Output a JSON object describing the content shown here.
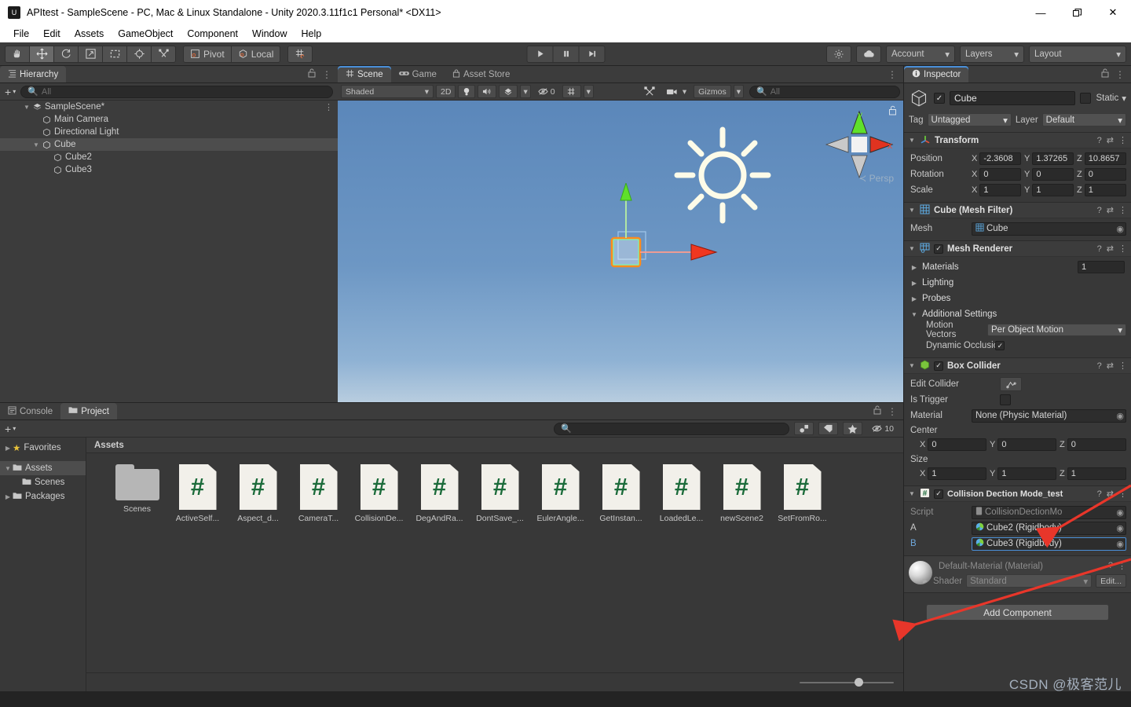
{
  "window": {
    "title": "APItest - SampleScene - PC, Mac & Linux Standalone - Unity 2020.3.11f1c1 Personal* <DX11>",
    "app_icon": "unity-icon",
    "minimize": "—",
    "maximize": "❐",
    "close": "✕"
  },
  "menubar": {
    "items": [
      "File",
      "Edit",
      "Assets",
      "GameObject",
      "Component",
      "Window",
      "Help"
    ]
  },
  "toolbar": {
    "tools": [
      {
        "name": "hand-tool",
        "glyph": "✋",
        "active": false
      },
      {
        "name": "move-tool",
        "glyph": "✥",
        "active": true
      },
      {
        "name": "rotate-tool",
        "glyph": "↺",
        "active": false
      },
      {
        "name": "scale-tool",
        "glyph": "⤡",
        "active": false
      },
      {
        "name": "rect-tool",
        "glyph": "⬚",
        "active": false
      },
      {
        "name": "transform-tool",
        "glyph": "⊕",
        "active": false
      },
      {
        "name": "custom-tool",
        "glyph": "⚒",
        "active": false
      }
    ],
    "pivot_label": "Pivot",
    "local_label": "Local",
    "grid_snap": "grid-snap-icon",
    "play": "▶",
    "pause": "❚❚",
    "step": "▶|",
    "collab_icon": "cloud-icon",
    "services_icon": "services-icon",
    "account_label": "Account",
    "layers_label": "Layers",
    "layout_label": "Layout"
  },
  "hierarchy": {
    "tab_label": "Hierarchy",
    "tab_icon": "hierarchy-icon",
    "create_label": "+",
    "search_placeholder": "All",
    "items": [
      {
        "label": "SampleScene*",
        "icon": "scene-icon",
        "depth": 0,
        "expanded": true,
        "selected": false,
        "has_menu": true
      },
      {
        "label": "Main Camera",
        "icon": "gameobject-icon",
        "depth": 1,
        "expanded": null,
        "selected": false
      },
      {
        "label": "Directional Light",
        "icon": "gameobject-icon",
        "depth": 1,
        "expanded": null,
        "selected": false
      },
      {
        "label": "Cube",
        "icon": "gameobject-icon",
        "depth": 1,
        "expanded": true,
        "selected": true
      },
      {
        "label": "Cube2",
        "icon": "gameobject-icon",
        "depth": 2,
        "expanded": null,
        "selected": false
      },
      {
        "label": "Cube3",
        "icon": "gameobject-icon",
        "depth": 2,
        "expanded": null,
        "selected": false
      }
    ]
  },
  "scene": {
    "tabs": [
      {
        "label": "Scene",
        "icon": "scene-grid-icon",
        "active": true
      },
      {
        "label": "Game",
        "icon": "game-icon",
        "active": false
      },
      {
        "label": "Asset Store",
        "icon": "store-icon",
        "active": false
      }
    ],
    "draw_mode": "Shaded",
    "mode_2d": "2D",
    "lighting_icon": "lighting-icon",
    "audio_icon": "audio-icon",
    "fx_icon": "fx-icon",
    "hidden_count": "0",
    "grid_icon": "grid-icon",
    "scene_camera_icon": "scene-camera-icon",
    "camera_icon": "camera-icon",
    "gizmos_label": "Gizmos",
    "search_placeholder": "All",
    "axis_gizmo": {
      "y": "y",
      "x": "x",
      "persp": "≺ Persp"
    },
    "lock_icon": "lock-icon"
  },
  "inspector": {
    "tab_label": "Inspector",
    "tab_icon": "info-icon",
    "object_name": "Cube",
    "object_enabled": true,
    "static_label": "Static",
    "tag_label": "Tag",
    "tag_value": "Untagged",
    "layer_label": "Layer",
    "layer_value": "Default",
    "components": [
      {
        "name": "Transform",
        "icon": "transform-icon",
        "expanded": true,
        "has_checkbox": false,
        "rows": [
          {
            "label": "Position",
            "type": "vec3",
            "x": "-2.3608",
            "y": "1.37265",
            "z": "10.8657"
          },
          {
            "label": "Rotation",
            "type": "vec3",
            "x": "0",
            "y": "0",
            "z": "0"
          },
          {
            "label": "Scale",
            "type": "vec3",
            "x": "1",
            "y": "1",
            "z": "1"
          }
        ]
      },
      {
        "name": "Cube (Mesh Filter)",
        "icon": "mesh-filter-icon",
        "expanded": true,
        "has_checkbox": false,
        "rows": [
          {
            "label": "Mesh",
            "type": "object",
            "value": "Cube",
            "value_icon": "mesh-icon"
          }
        ]
      },
      {
        "name": "Mesh Renderer",
        "icon": "mesh-renderer-icon",
        "expanded": true,
        "has_checkbox": true,
        "checked": true,
        "rows": [
          {
            "label": "Materials",
            "type": "foldout",
            "value": "1"
          },
          {
            "label": "Lighting",
            "type": "foldout",
            "value": ""
          },
          {
            "label": "Probes",
            "type": "foldout",
            "value": ""
          },
          {
            "label": "Additional Settings",
            "type": "foldout-open",
            "value": ""
          },
          {
            "label": "Motion Vectors",
            "type": "dropdown",
            "value": "Per Object Motion",
            "indent": true
          },
          {
            "label": "Dynamic Occlusion",
            "type": "checkbox",
            "value": true,
            "indent": true
          }
        ]
      },
      {
        "name": "Box Collider",
        "icon": "box-collider-icon",
        "expanded": true,
        "has_checkbox": true,
        "checked": true,
        "rows": [
          {
            "label": "Edit Collider",
            "type": "button",
            "value": "edit-collider-icon"
          },
          {
            "label": "Is Trigger",
            "type": "checkbox",
            "value": false
          },
          {
            "label": "Material",
            "type": "object",
            "value": "None (Physic Material)"
          },
          {
            "label": "Center",
            "type": "vec3-label"
          },
          {
            "label": "",
            "type": "vec3",
            "x": "0",
            "y": "0",
            "z": "0"
          },
          {
            "label": "Size",
            "type": "vec3-label"
          },
          {
            "label": "",
            "type": "vec3",
            "x": "1",
            "y": "1",
            "z": "1"
          }
        ]
      },
      {
        "name": "Collision Dection Mode_test",
        "icon": "script-icon",
        "expanded": true,
        "has_checkbox": true,
        "checked": true,
        "rows": [
          {
            "label": "Script",
            "type": "object-disabled",
            "value": "CollisionDectionMo"
          },
          {
            "label": "A",
            "type": "object",
            "value": "Cube2 (Rigidbody)",
            "value_icon": "prefab-icon"
          },
          {
            "label": "B",
            "type": "object-highlight",
            "value": "Cube3 (Rigidbody)",
            "value_icon": "prefab-icon"
          }
        ]
      }
    ],
    "material_card": {
      "title": "Default-Material (Material)",
      "shader_label": "Shader",
      "shader_value": "Standard",
      "edit_label": "Edit..."
    },
    "add_component_label": "Add Component"
  },
  "project": {
    "tabs": [
      {
        "label": "Console",
        "icon": "console-icon",
        "active": false
      },
      {
        "label": "Project",
        "icon": "project-icon",
        "active": true
      }
    ],
    "create_label": "+",
    "search_placeholder": "",
    "toolbar_icons": [
      "pick-icon",
      "label-icon",
      "favorite-icon",
      "hidden-icon"
    ],
    "hidden_count": "10",
    "tree": [
      {
        "label": "Favorites",
        "icon": "star-icon",
        "depth": 0,
        "expanded": false,
        "selected": false
      },
      {
        "label": "Assets",
        "icon": "folder-icon",
        "depth": 0,
        "expanded": true,
        "selected": true
      },
      {
        "label": "Scenes",
        "icon": "folder-icon",
        "depth": 1,
        "expanded": null,
        "selected": false
      },
      {
        "label": "Packages",
        "icon": "folder-icon",
        "depth": 0,
        "expanded": false,
        "selected": false
      }
    ],
    "breadcrumb": "Assets",
    "assets": [
      {
        "label": "Scenes",
        "type": "folder"
      },
      {
        "label": "ActiveSelf...",
        "type": "script"
      },
      {
        "label": "Aspect_d...",
        "type": "script"
      },
      {
        "label": "CameraT...",
        "type": "script"
      },
      {
        "label": "CollisionDe...",
        "type": "script"
      },
      {
        "label": "DegAndRa...",
        "type": "script"
      },
      {
        "label": "DontSave_...",
        "type": "script"
      },
      {
        "label": "EulerAngle...",
        "type": "script"
      },
      {
        "label": "GetInstan...",
        "type": "script"
      },
      {
        "label": "LoadedLe...",
        "type": "script"
      },
      {
        "label": "newScene2",
        "type": "script"
      },
      {
        "label": "SetFromRo...",
        "type": "script"
      }
    ],
    "zoom_value": "58"
  },
  "watermark": "CSDN @极客范儿",
  "colors": {
    "accent": "#4a90d9",
    "panel": "#383838",
    "panel_light": "#3c3c3c",
    "selection": "#4d4d4d",
    "annotation_arrow": "#e8362a",
    "script_green": "#1b6b3a"
  }
}
